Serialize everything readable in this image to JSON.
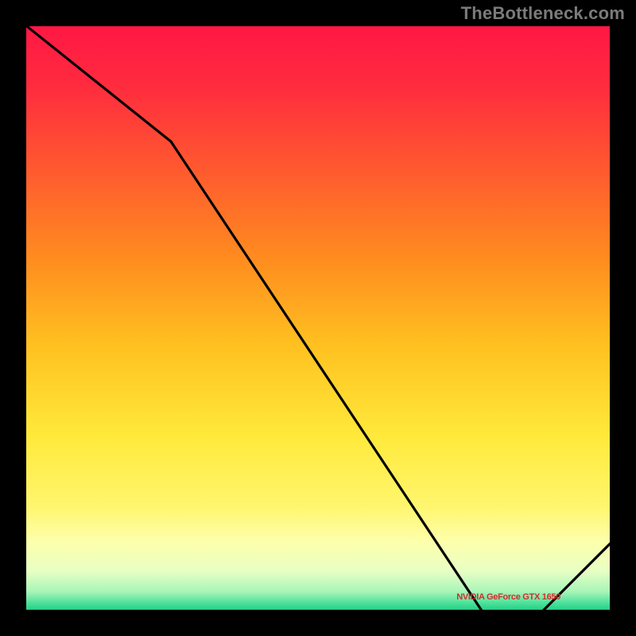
{
  "watermark": "TheBottleneck.com",
  "chart_data": {
    "type": "line",
    "title": "",
    "xlabel": "",
    "ylabel": "",
    "xlim": [
      0,
      100
    ],
    "ylim": [
      0,
      100
    ],
    "grid": false,
    "series": [
      {
        "name": "bottleneck-curve",
        "x": [
          0,
          25,
          78,
          82,
          88,
          100
        ],
        "values": [
          100,
          80,
          0,
          0,
          0,
          12
        ]
      }
    ],
    "annotations": [
      {
        "name": "optimal-label",
        "text": "NVIDIA GeForce GTX 1650",
        "x": 83,
        "y": 1
      }
    ],
    "background_gradient": {
      "stops": [
        {
          "offset": 0.0,
          "color": "#ff1744"
        },
        {
          "offset": 0.1,
          "color": "#ff2a3f"
        },
        {
          "offset": 0.25,
          "color": "#ff5a2f"
        },
        {
          "offset": 0.4,
          "color": "#ff8c1f"
        },
        {
          "offset": 0.55,
          "color": "#ffc220"
        },
        {
          "offset": 0.7,
          "color": "#ffe93a"
        },
        {
          "offset": 0.82,
          "color": "#fff66e"
        },
        {
          "offset": 0.88,
          "color": "#fdffab"
        },
        {
          "offset": 0.93,
          "color": "#e8ffc4"
        },
        {
          "offset": 0.965,
          "color": "#a8f5b8"
        },
        {
          "offset": 0.985,
          "color": "#4be09a"
        },
        {
          "offset": 1.0,
          "color": "#18c97e"
        }
      ]
    }
  }
}
